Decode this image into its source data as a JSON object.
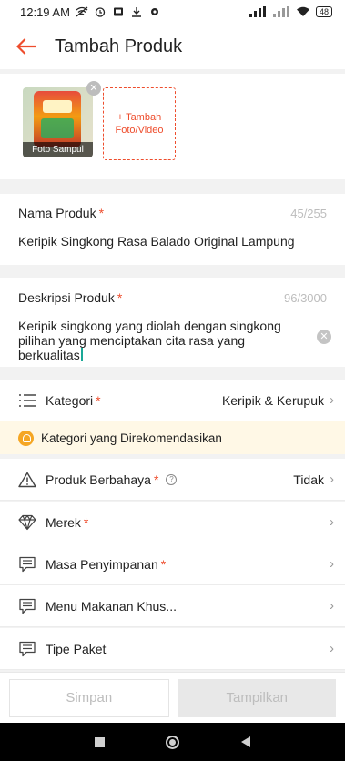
{
  "status_bar": {
    "time": "12:19 AM",
    "battery": "48"
  },
  "app_bar": {
    "title": "Tambah Produk",
    "back_icon": "arrow-left-icon"
  },
  "media": {
    "cover_caption": "Foto Sampul",
    "add_label": "+ Tambah Foto/Video"
  },
  "nama_produk": {
    "label": "Nama Produk",
    "required": "*",
    "count": "45/255",
    "value": "Keripik Singkong Rasa Balado Original Lampung"
  },
  "deskripsi": {
    "label": "Deskripsi Produk",
    "required": "*",
    "count": "96/3000",
    "value": "Keripik singkong yang diolah dengan singkong pilihan yang menciptakan cita rasa yang berkualitas"
  },
  "rows": [
    {
      "label": "Kategori",
      "required": "*",
      "value": "Keripik & Kerupuk",
      "icon": "list-icon"
    },
    {
      "label": "Produk Berbahaya",
      "required": "*",
      "value": "Tidak",
      "icon": "warning-icon"
    },
    {
      "label": "Merek",
      "required": "*",
      "value": "",
      "icon": "diamond-icon"
    },
    {
      "label": "Masa Penyimpanan",
      "required": "*",
      "value": "",
      "icon": "note-icon"
    },
    {
      "label": "Menu Makanan Khus...",
      "required": "",
      "value": "",
      "icon": "note-icon"
    },
    {
      "label": "Tipe Paket",
      "required": "",
      "value": "",
      "icon": "note-icon"
    }
  ],
  "recommendation": {
    "text": "Kategori yang Direkomendasikan"
  },
  "buttons": {
    "save": "Simpan",
    "publish": "Tampilkan"
  },
  "colors": {
    "accent": "#ee4d2d",
    "reco_bg": "#fff8e6",
    "bulb": "#f5a623"
  }
}
